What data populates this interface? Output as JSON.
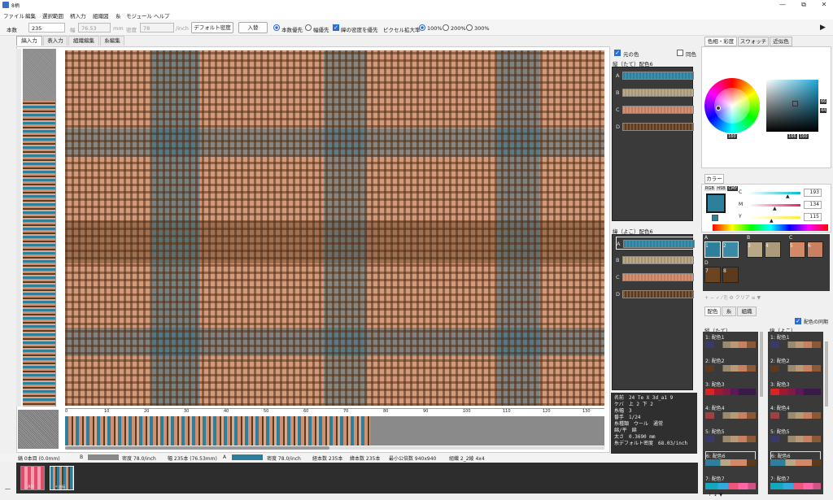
{
  "window": {
    "title": "8柄",
    "minimize": "—",
    "maximize": "⧉",
    "close": "✕"
  },
  "menu": [
    "ファイル",
    "編集",
    "選択範囲",
    "柄入力",
    "組織図",
    "糸",
    "モジュール",
    "ヘルプ"
  ],
  "toolbar": {
    "count_label": "本数",
    "count_value": "235",
    "width_label": "幅",
    "width_value": "76.53",
    "width_unit": "mm",
    "density_label": "密度",
    "density_value": "78",
    "density_unit": "/inch",
    "default_density_btn": "デフォルト密度",
    "swap_btn": "入替",
    "opt_count": "本数優先",
    "opt_width": "幅優先",
    "opt_weft_density": "緯の密度を優先",
    "pixel_zoom_label": "ピクセル拡大率",
    "zoom_100": "100%",
    "zoom_200": "200%",
    "zoom_300": "300%",
    "expand": "▶"
  },
  "tabs": [
    "縞入力",
    "表入力",
    "組織編集",
    "糸編集"
  ],
  "ruler_h": [
    "0",
    "10",
    "20",
    "30",
    "40",
    "50",
    "60",
    "70",
    "80",
    "90",
    "100",
    "110",
    "120",
    "130"
  ],
  "mid": {
    "same_color_label": "元の色",
    "dup_label": "同色",
    "warp_title": "縦（たて）配色6",
    "weft_title": "緯（よこ）配色6",
    "letters": [
      "A",
      "B",
      "C",
      "D"
    ]
  },
  "yarn_info": [
    "名前　24 Te X 3d_a1 9",
    "ケバ　上 2 下 2",
    "糸幅　3",
    "番手　1/24",
    "糸種類　ウール　通常",
    "綿/平　綿",
    "太さ　0.3690 mm",
    "糸デフォルト密度　68.03/inch"
  ],
  "right": {
    "tabs": [
      "色相・彩度",
      "スウォッチ",
      "近似色"
    ],
    "hue_value": "160",
    "sv_s": "66",
    "sv_v": "44",
    "sv_x": "166",
    "sv_y": "160",
    "color_tab": "カラー",
    "modes": [
      "RGB",
      "HSB",
      "CMY"
    ],
    "c_label": "C",
    "m_label": "M",
    "y_label": "Y",
    "c_value": "193",
    "m_value": "134",
    "y_value": "115",
    "palette_groups": [
      "A",
      "B",
      "C",
      "D"
    ],
    "palette_nums": [
      "1",
      "2",
      "3",
      "4",
      "5",
      "6",
      "7",
      "8"
    ],
    "palette_tools": "+ − ✓ ⁄ ⎘ ⚙ クリア ≡ ▼",
    "bottom_tabs": [
      "配色",
      "糸",
      "組織"
    ],
    "sync_label": "配色の同期",
    "warp_list_title": "縦（たて）",
    "weft_list_title": "緯（よこ）",
    "color_sets": [
      "1: 配色1",
      "2: 配色2",
      "3: 配色3",
      "4: 配色4",
      "5: 配色5",
      "6: 配色6",
      "7: 配色7"
    ],
    "arrows": "↑ ↓ ▼"
  },
  "status": {
    "position": "縞 0本目 (0.0mm)",
    "b_label": "B",
    "b_density": "密度 78.0/inch",
    "b_width": "幅 235本 (76.53mm)",
    "a_label": "A",
    "a_density": "密度 78.0/inch",
    "warp_count": "経本数 235本",
    "weft_count": "緯本数 235本",
    "min_repeat": "最小公倍数 940x940",
    "weave": "組織 2_2綾 4x4"
  },
  "thumbs": [
    {
      "label": "AI6"
    },
    {
      "label": "* 8柄"
    }
  ],
  "colors": {
    "teal": "#2e7f9c",
    "salmon": "#d29072",
    "brown": "#5b3a1e",
    "accent": "#2a6fd6"
  }
}
